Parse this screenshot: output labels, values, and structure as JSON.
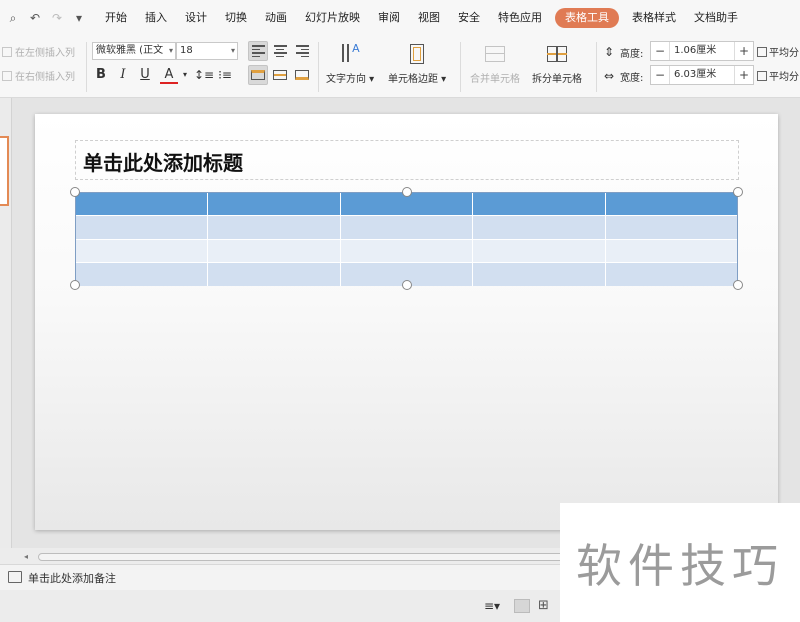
{
  "menubar": {
    "tabs": [
      "开始",
      "插入",
      "设计",
      "切换",
      "动画",
      "幻灯片放映",
      "审阅",
      "视图",
      "安全",
      "特色应用",
      "表格工具",
      "表格样式",
      "文档助手"
    ],
    "active_tab": "表格工具"
  },
  "ribbon": {
    "insert_left": "在左侧插入列",
    "insert_right": "在右侧插入列",
    "font_name": "微软雅黑 (正文",
    "font_size": "18",
    "text_direction": "文字方向",
    "cell_margin": "单元格边距",
    "merge_cells": "合并单元格",
    "split_cells": "拆分单元格",
    "height_label": "高度:",
    "height_value": "1.06厘米",
    "width_label": "宽度:",
    "width_value": "6.03厘米",
    "distribute_rows": "平均分",
    "distribute_cols": "平均分"
  },
  "slide": {
    "title_placeholder": "单击此处添加标题",
    "table_columns": 5,
    "table_rows": 4
  },
  "notes": {
    "placeholder": "单击此处添加备注"
  },
  "watermark": {
    "text": "软件技巧"
  },
  "colors": {
    "accent_tab": "#e07b54",
    "table_header": "#5b9bd5",
    "table_band_odd": "#d2dff0",
    "table_band_even": "#e9eff7"
  },
  "icons": [
    "print-preview-icon",
    "undo-icon",
    "redo-icon",
    "dropdown-icon",
    "bold-icon",
    "italic-icon",
    "underline-icon",
    "font-color-icon",
    "line-spacing-icon",
    "bullet-list-icon",
    "align-left-icon",
    "align-center-icon",
    "align-right-icon",
    "text-direction-icon",
    "cell-margin-icon",
    "merge-cells-icon",
    "split-cells-icon",
    "row-height-icon",
    "column-width-icon",
    "notes-icon",
    "normal-view-icon",
    "slide-sorter-icon"
  ]
}
